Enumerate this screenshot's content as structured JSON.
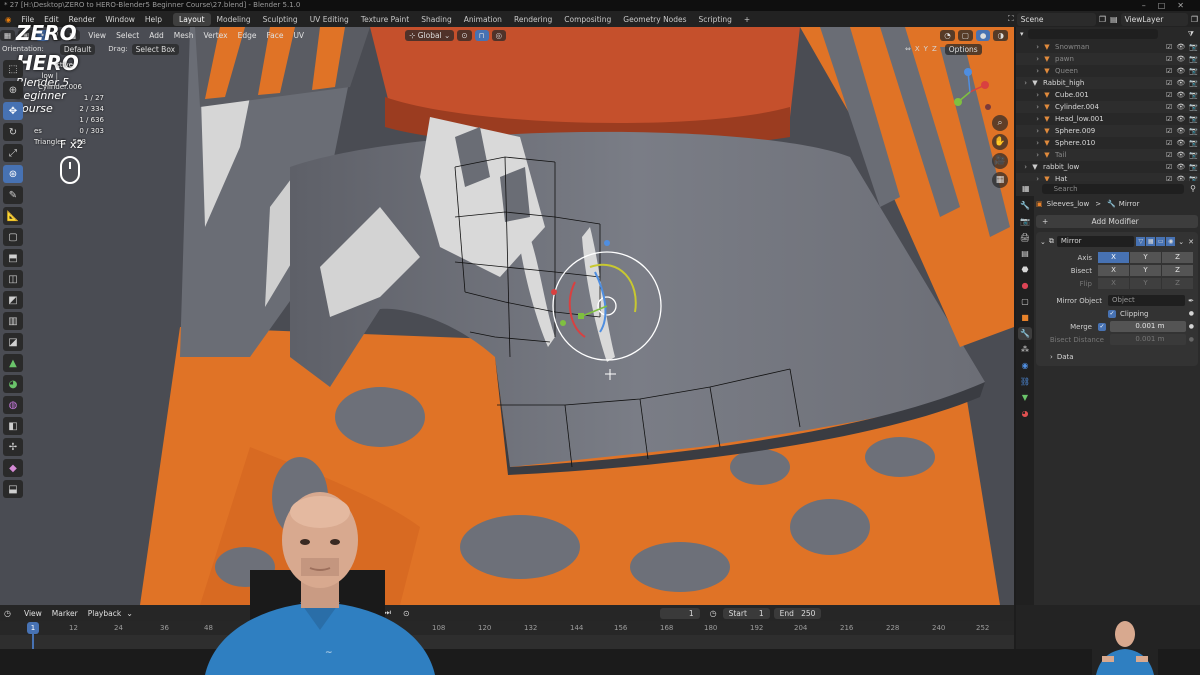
{
  "window": {
    "title": "* 27 [H:\\Desktop\\ZERO to HERO-Blender5 Beginner Course\\27.blend] - Blender 5.1.0"
  },
  "menus": [
    "File",
    "Edit",
    "Render",
    "Window",
    "Help"
  ],
  "workspaces": [
    {
      "label": "Layout",
      "active": true
    },
    {
      "label": "Modeling",
      "active": false
    },
    {
      "label": "Sculpting",
      "active": false
    },
    {
      "label": "UV Editing",
      "active": false
    },
    {
      "label": "Texture Paint",
      "active": false
    },
    {
      "label": "Shading",
      "active": false
    },
    {
      "label": "Animation",
      "active": false
    },
    {
      "label": "Rendering",
      "active": false
    },
    {
      "label": "Compositing",
      "active": false
    },
    {
      "label": "Geometry Nodes",
      "active": false
    },
    {
      "label": "Scripting",
      "active": false
    }
  ],
  "add_workspace": "+",
  "scene": {
    "label": "Scene"
  },
  "view_layer": {
    "label": "ViewLayer"
  },
  "viewport_header": {
    "orientation_label": "Orientation:",
    "orientation_value": "Default",
    "drag_label": "Drag:",
    "drag_value": "Select Box",
    "menus": [
      "View",
      "Select",
      "Add",
      "Mesh",
      "Vertex",
      "Edge",
      "Face",
      "UV"
    ],
    "transform_orientation": "Global",
    "axes": [
      "X",
      "Y",
      "Z"
    ],
    "options": "Options"
  },
  "logo": {
    "line1": "ZERO",
    "line2": "HERO",
    "line3": "Blender 5",
    "line4": "Beginner",
    "line5": "course"
  },
  "stats": {
    "mode": "ctive",
    "object": "_low | Cylinder.006",
    "rows": [
      {
        "label": "",
        "value": "1 / 27"
      },
      {
        "label": "",
        "value": "2 / 334"
      },
      {
        "label": "",
        "value": "1 / 636"
      },
      {
        "label": "es",
        "value": "0 / 303"
      },
      {
        "label": "Triangles",
        "value": "588"
      }
    ]
  },
  "key_hint": "F x2",
  "outliner": {
    "search_placeholder": "",
    "rows": [
      {
        "name": "Snowman",
        "dim": true,
        "icon_color": "#e08a3c"
      },
      {
        "name": "pawn",
        "dim": true,
        "icon_color": "#e08a3c"
      },
      {
        "name": "Queen",
        "dim": true,
        "icon_color": "#e08a3c"
      },
      {
        "name": "Rabbit_high",
        "dim": false,
        "icon_color": "#cccccc"
      },
      {
        "name": "Cube.001",
        "dim": false,
        "icon_color": "#e08a3c"
      },
      {
        "name": "Cylinder.004",
        "dim": false,
        "icon_color": "#e08a3c"
      },
      {
        "name": "Head_low.001",
        "dim": false,
        "icon_color": "#e08a3c"
      },
      {
        "name": "Sphere.009",
        "dim": false,
        "icon_color": "#e08a3c"
      },
      {
        "name": "Sphere.010",
        "dim": false,
        "icon_color": "#e08a3c"
      },
      {
        "name": "Tail",
        "dim": true,
        "icon_color": "#e08a3c"
      },
      {
        "name": "rabbit_low",
        "dim": false,
        "icon_color": "#cccccc"
      },
      {
        "name": "Hat",
        "dim": false,
        "icon_color": "#e08a3c"
      }
    ]
  },
  "properties": {
    "search_placeholder": "Search",
    "breadcrumb_object": "Sleeves_low",
    "breadcrumb_sep": ">",
    "breadcrumb_modifier": "Mirror",
    "add_modifier": "Add Modifier",
    "modifier_name": "Mirror",
    "axis_label": "Axis",
    "bisect_label": "Bisect",
    "flip_label": "Flip",
    "axis_buttons": [
      "X",
      "Y",
      "Z"
    ],
    "mirror_object_label": "Mirror Object",
    "mirror_object_placeholder": "Object",
    "clipping_label": "Clipping",
    "merge_label": "Merge",
    "merge_value": "0.001 m",
    "bisect_distance_label": "Bisect Distance",
    "bisect_distance_value": "0.001 m",
    "data_label": "Data"
  },
  "timeline": {
    "menus": [
      "View",
      "Marker",
      "Playback"
    ],
    "current_frame": "1",
    "start_label": "Start",
    "start_value": "1",
    "end_label": "End",
    "end_value": "250",
    "playhead": "1",
    "ticks": [
      "12",
      "24",
      "36",
      "48",
      "108",
      "120",
      "132",
      "144",
      "156",
      "168",
      "180",
      "192",
      "204",
      "216",
      "228",
      "240",
      "252"
    ]
  },
  "colors": {
    "accent": "#4772b3",
    "mesh_gray": "#6e7078",
    "orange": "#e8782a",
    "hat_red": "#c9532c"
  }
}
